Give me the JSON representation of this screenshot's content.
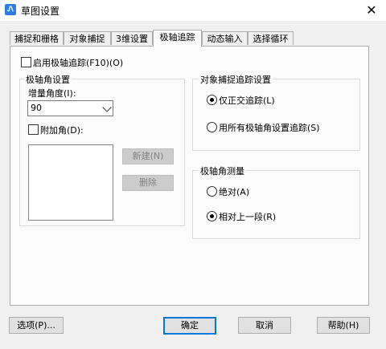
{
  "window": {
    "title": "草图设置",
    "app_icon_glyph": "Ꮑ",
    "close_glyph": "✕"
  },
  "tabs": [
    {
      "label": "捕捉和栅格",
      "active": false
    },
    {
      "label": "对象捕捉",
      "active": false
    },
    {
      "label": "3维设置",
      "active": false
    },
    {
      "label": "极轴追踪",
      "active": true
    },
    {
      "label": "动态输入",
      "active": false
    },
    {
      "label": "选择循环",
      "active": false
    }
  ],
  "polar": {
    "enable_label": "启用极轴追踪(F10)(O)",
    "enable_checked": false,
    "angle_group_title": "极轴角设置",
    "increment_label": "增量角度(I):",
    "increment_value": "90",
    "additional_label": "附加角(D):",
    "additional_checked": false,
    "new_button": "新建(N)",
    "delete_button": "删除"
  },
  "snap_tracking": {
    "group_title": "对象捕捉追踪设置",
    "option_ortho": "仅正交追踪(L)",
    "option_all": "用所有极轴角设置追踪(S)",
    "selected": "ortho"
  },
  "measurement": {
    "group_title": "极轴角测量",
    "option_absolute": "绝对(A)",
    "option_relative": "相对上一段(R)",
    "selected": "relative"
  },
  "footer": {
    "options_button": "选项(P)...",
    "ok_button": "确定",
    "cancel_button": "取消",
    "help_button": "帮助(H)"
  },
  "colors": {
    "default_button_border": "#0078d7",
    "panel_bg": "#fbfbfb",
    "window_bg": "#f0f0f0"
  },
  "icons": {
    "app": "drafting-app-icon",
    "close": "close-icon",
    "dropdown": "chevron-down-icon"
  }
}
